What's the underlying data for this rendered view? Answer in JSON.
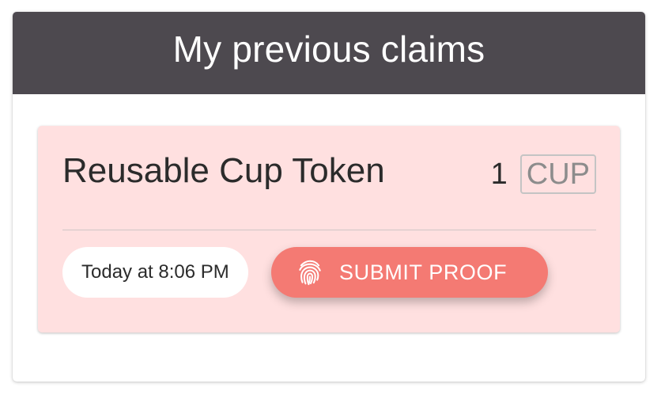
{
  "header": {
    "title": "My previous claims"
  },
  "claims": [
    {
      "name": "Reusable Cup Token",
      "amount": "1",
      "unit": "CUP",
      "timestamp": "Today at 8:06 PM",
      "action_label": "SUBMIT PROOF",
      "action_icon": "fingerprint-icon"
    }
  ],
  "colors": {
    "header_bg": "#4d494f",
    "card_bg": "#ffe0e0",
    "button_bg": "#f47a73"
  }
}
